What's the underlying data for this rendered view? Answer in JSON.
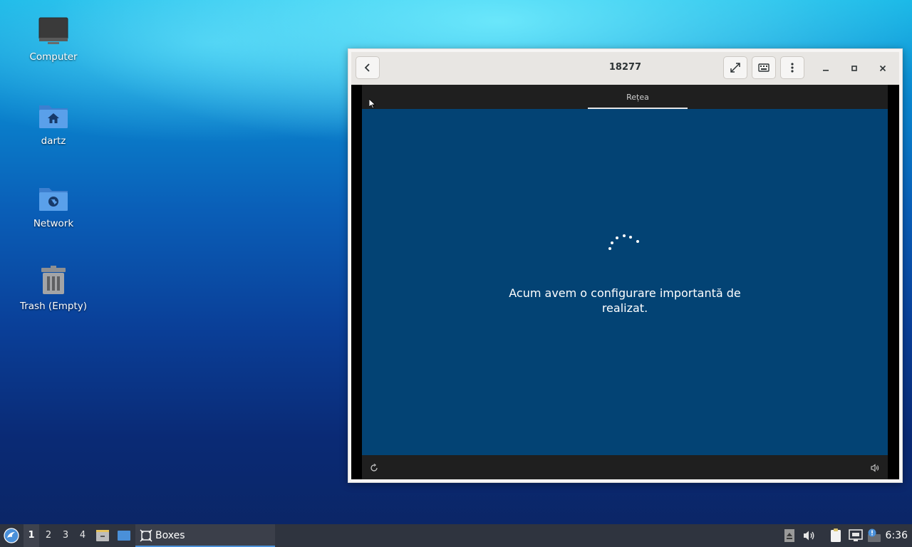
{
  "desktop": {
    "icons": [
      {
        "label": "Computer",
        "icon": "monitor-icon"
      },
      {
        "label": "dartz",
        "icon": "home-folder-icon"
      },
      {
        "label": "Network",
        "icon": "network-folder-icon"
      },
      {
        "label": "Trash (Empty)",
        "icon": "trash-icon"
      }
    ]
  },
  "window": {
    "title": "18277",
    "buttons": [
      "back-icon",
      "fullscreen-icon",
      "keyboard-icon",
      "menu-dots-icon",
      "minimize-icon",
      "maximize-icon",
      "close-icon"
    ]
  },
  "vm": {
    "tab_label": "Rețea",
    "message_line1": "Acum avem o configurare importantă de",
    "message_line2": "realizat.",
    "colors": {
      "screen_blue": "#034374",
      "bar": "#1f1f1f"
    }
  },
  "taskbar": {
    "workspaces": [
      "1",
      "2",
      "3",
      "4"
    ],
    "active_workspace": "1",
    "task_label": "Boxes",
    "clock": "6:36",
    "accent": "#4a90d9"
  }
}
